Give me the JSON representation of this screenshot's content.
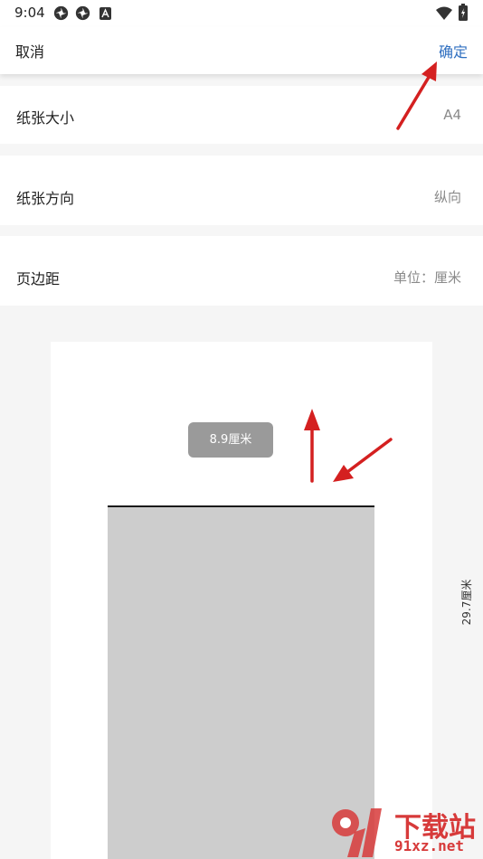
{
  "status_bar": {
    "time": "9:04",
    "icons": [
      "pinwheel-icon",
      "pinwheel-icon",
      "font-a-icon",
      "wifi-icon",
      "battery-icon"
    ]
  },
  "toolbar": {
    "cancel_label": "取消",
    "confirm_label": "确定",
    "confirm_color": "#2f6fc0"
  },
  "settings": {
    "paper_size": {
      "label": "纸张大小",
      "value": "A4"
    },
    "orientation": {
      "label": "纸张方向",
      "value": "纵向"
    },
    "margins": {
      "label": "页边距",
      "value": "单位：厘米"
    }
  },
  "preview": {
    "margin_tooltip": "8.9厘米",
    "height_label": "29.7厘米"
  },
  "watermark": {
    "text": "下载站",
    "url": "91xz.net"
  },
  "colors": {
    "annotation_arrow": "#d42020",
    "content_box": "#cdcdcd"
  }
}
